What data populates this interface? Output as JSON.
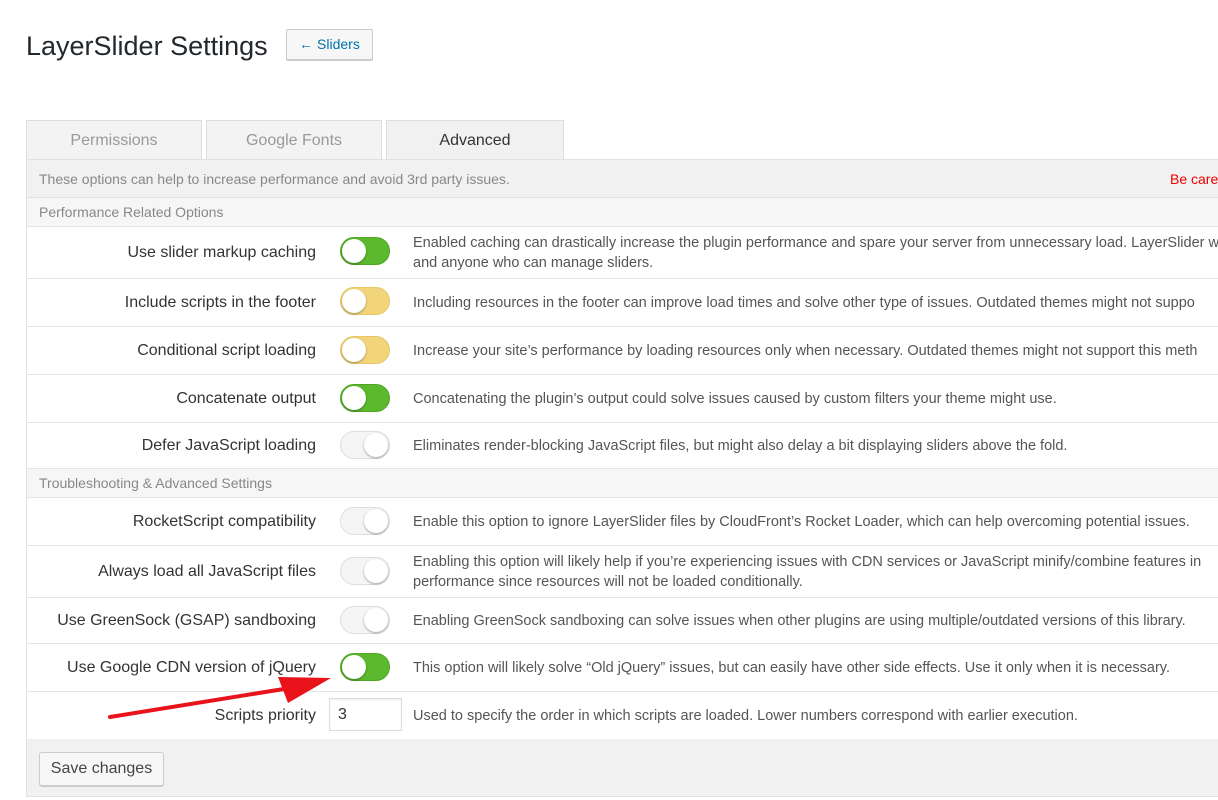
{
  "header": {
    "title": "LayerSlider Settings",
    "back_button": "← Sliders"
  },
  "tabs": [
    {
      "label": "Permissions",
      "active": false
    },
    {
      "label": "Google Fonts",
      "active": false
    },
    {
      "label": "Advanced",
      "active": true
    }
  ],
  "notice": {
    "text": "These options can help to increase performance and avoid 3rd party issues.",
    "warning": "Be care",
    "warning_color": "#e00000"
  },
  "sections": [
    {
      "title": "Performance Related Options",
      "rows": [
        {
          "label": "Use slider markup caching",
          "state": "on",
          "desc": [
            "Enabled caching can drastically increase the plugin performance and spare your server from unnecessary load. LayerSlider w",
            "and anyone who can manage sliders."
          ]
        },
        {
          "label": "Include scripts in the footer",
          "state": "warn",
          "desc": [
            "Including resources in the footer can improve load times and solve other type of issues. Outdated themes might not suppo"
          ]
        },
        {
          "label": "Conditional script loading",
          "state": "warn",
          "desc": [
            "Increase your site’s performance by loading resources only when necessary. Outdated themes might not support this meth"
          ]
        },
        {
          "label": "Concatenate output",
          "state": "on",
          "desc": [
            "Concatenating the plugin’s output could solve issues caused by custom filters your theme might use."
          ]
        },
        {
          "label": "Defer JavaScript loading",
          "state": "off",
          "desc": [
            "Eliminates render-blocking JavaScript files, but might also delay a bit displaying sliders above the fold."
          ]
        }
      ]
    },
    {
      "title": "Troubleshooting & Advanced Settings",
      "rows": [
        {
          "label": "RocketScript compatibility",
          "state": "off",
          "desc": [
            "Enable this option to ignore LayerSlider files by CloudFront’s Rocket Loader, which can help overcoming potential issues."
          ]
        },
        {
          "label": "Always load all JavaScript files",
          "state": "off",
          "desc": [
            "Enabling this option will likely help if you’re experiencing issues with CDN services or JavaScript minify/combine features in",
            "performance since resources will not be loaded conditionally."
          ]
        },
        {
          "label": "Use GreenSock (GSAP) sandboxing",
          "state": "off",
          "desc": [
            "Enabling GreenSock sandboxing can solve issues when other plugins are using multiple/outdated versions of this library."
          ]
        },
        {
          "label": "Use Google CDN version of jQuery",
          "state": "on",
          "desc": [
            "This option will likely solve “Old jQuery” issues, but can easily have other side effects. Use it only when it is necessary."
          ]
        },
        {
          "label": "Scripts priority",
          "type": "number",
          "value": "3",
          "desc": [
            "Used to specify the order in which scripts are loaded. Lower numbers correspond with earlier execution."
          ]
        }
      ]
    }
  ],
  "footer": {
    "save_label": "Save changes"
  },
  "colors": {
    "toggle_on": "#5cb92d",
    "toggle_warn": "#f2d57a",
    "toggle_off": "#f5f5f5",
    "annotation_arrow": "#e8131b",
    "link": "#0073aa"
  }
}
